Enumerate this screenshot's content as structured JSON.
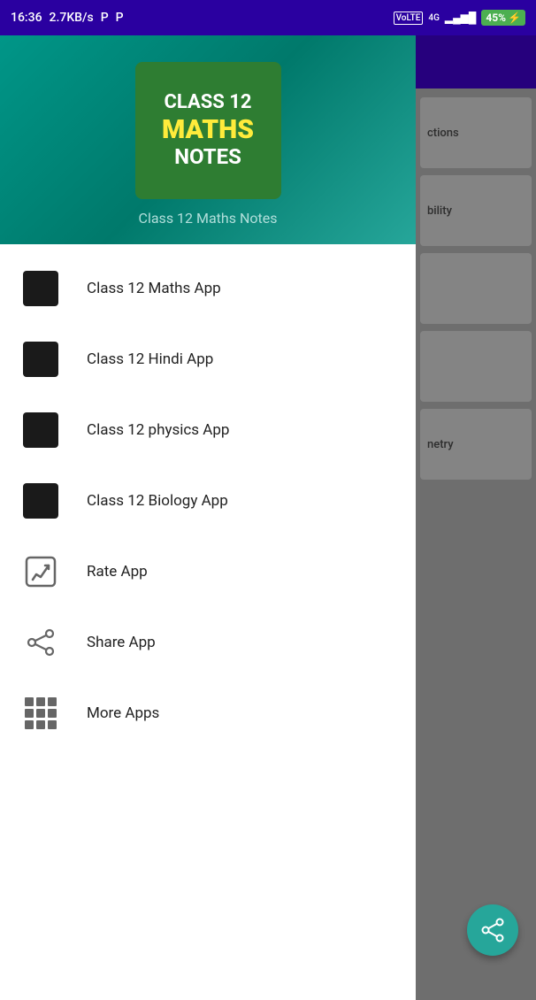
{
  "statusBar": {
    "time": "16:36",
    "networkSpeed": "2.7KB/s",
    "carrier1": "P",
    "carrier2": "P",
    "networkType": "4G",
    "volte": "VoLTE",
    "signalBars": "▂▄▆█",
    "batteryPercent": "45",
    "batterySymbol": "⚡"
  },
  "drawer": {
    "appLogoLine1": "CLASS 12",
    "appLogoLine2": "MATHS",
    "appLogoLine3": "NOTES",
    "appName": "Class 12 Maths Notes",
    "menuItems": [
      {
        "id": "maths",
        "label": "Class 12 Maths App",
        "iconType": "black-square"
      },
      {
        "id": "hindi",
        "label": "Class 12 Hindi App",
        "iconType": "black-square"
      },
      {
        "id": "physics",
        "label": "Class 12 physics App",
        "iconType": "black-square"
      },
      {
        "id": "biology",
        "label": "Class 12 Biology App",
        "iconType": "black-square"
      },
      {
        "id": "rate",
        "label": "Rate App",
        "iconType": "rate"
      },
      {
        "id": "share",
        "label": "Share App",
        "iconType": "share"
      },
      {
        "id": "more",
        "label": "More Apps",
        "iconType": "grid"
      }
    ]
  },
  "rightPanel": {
    "items": [
      {
        "text": "ctions"
      },
      {
        "text": "bility"
      },
      {
        "text": ""
      },
      {
        "text": ""
      },
      {
        "text": "netry"
      }
    ]
  }
}
